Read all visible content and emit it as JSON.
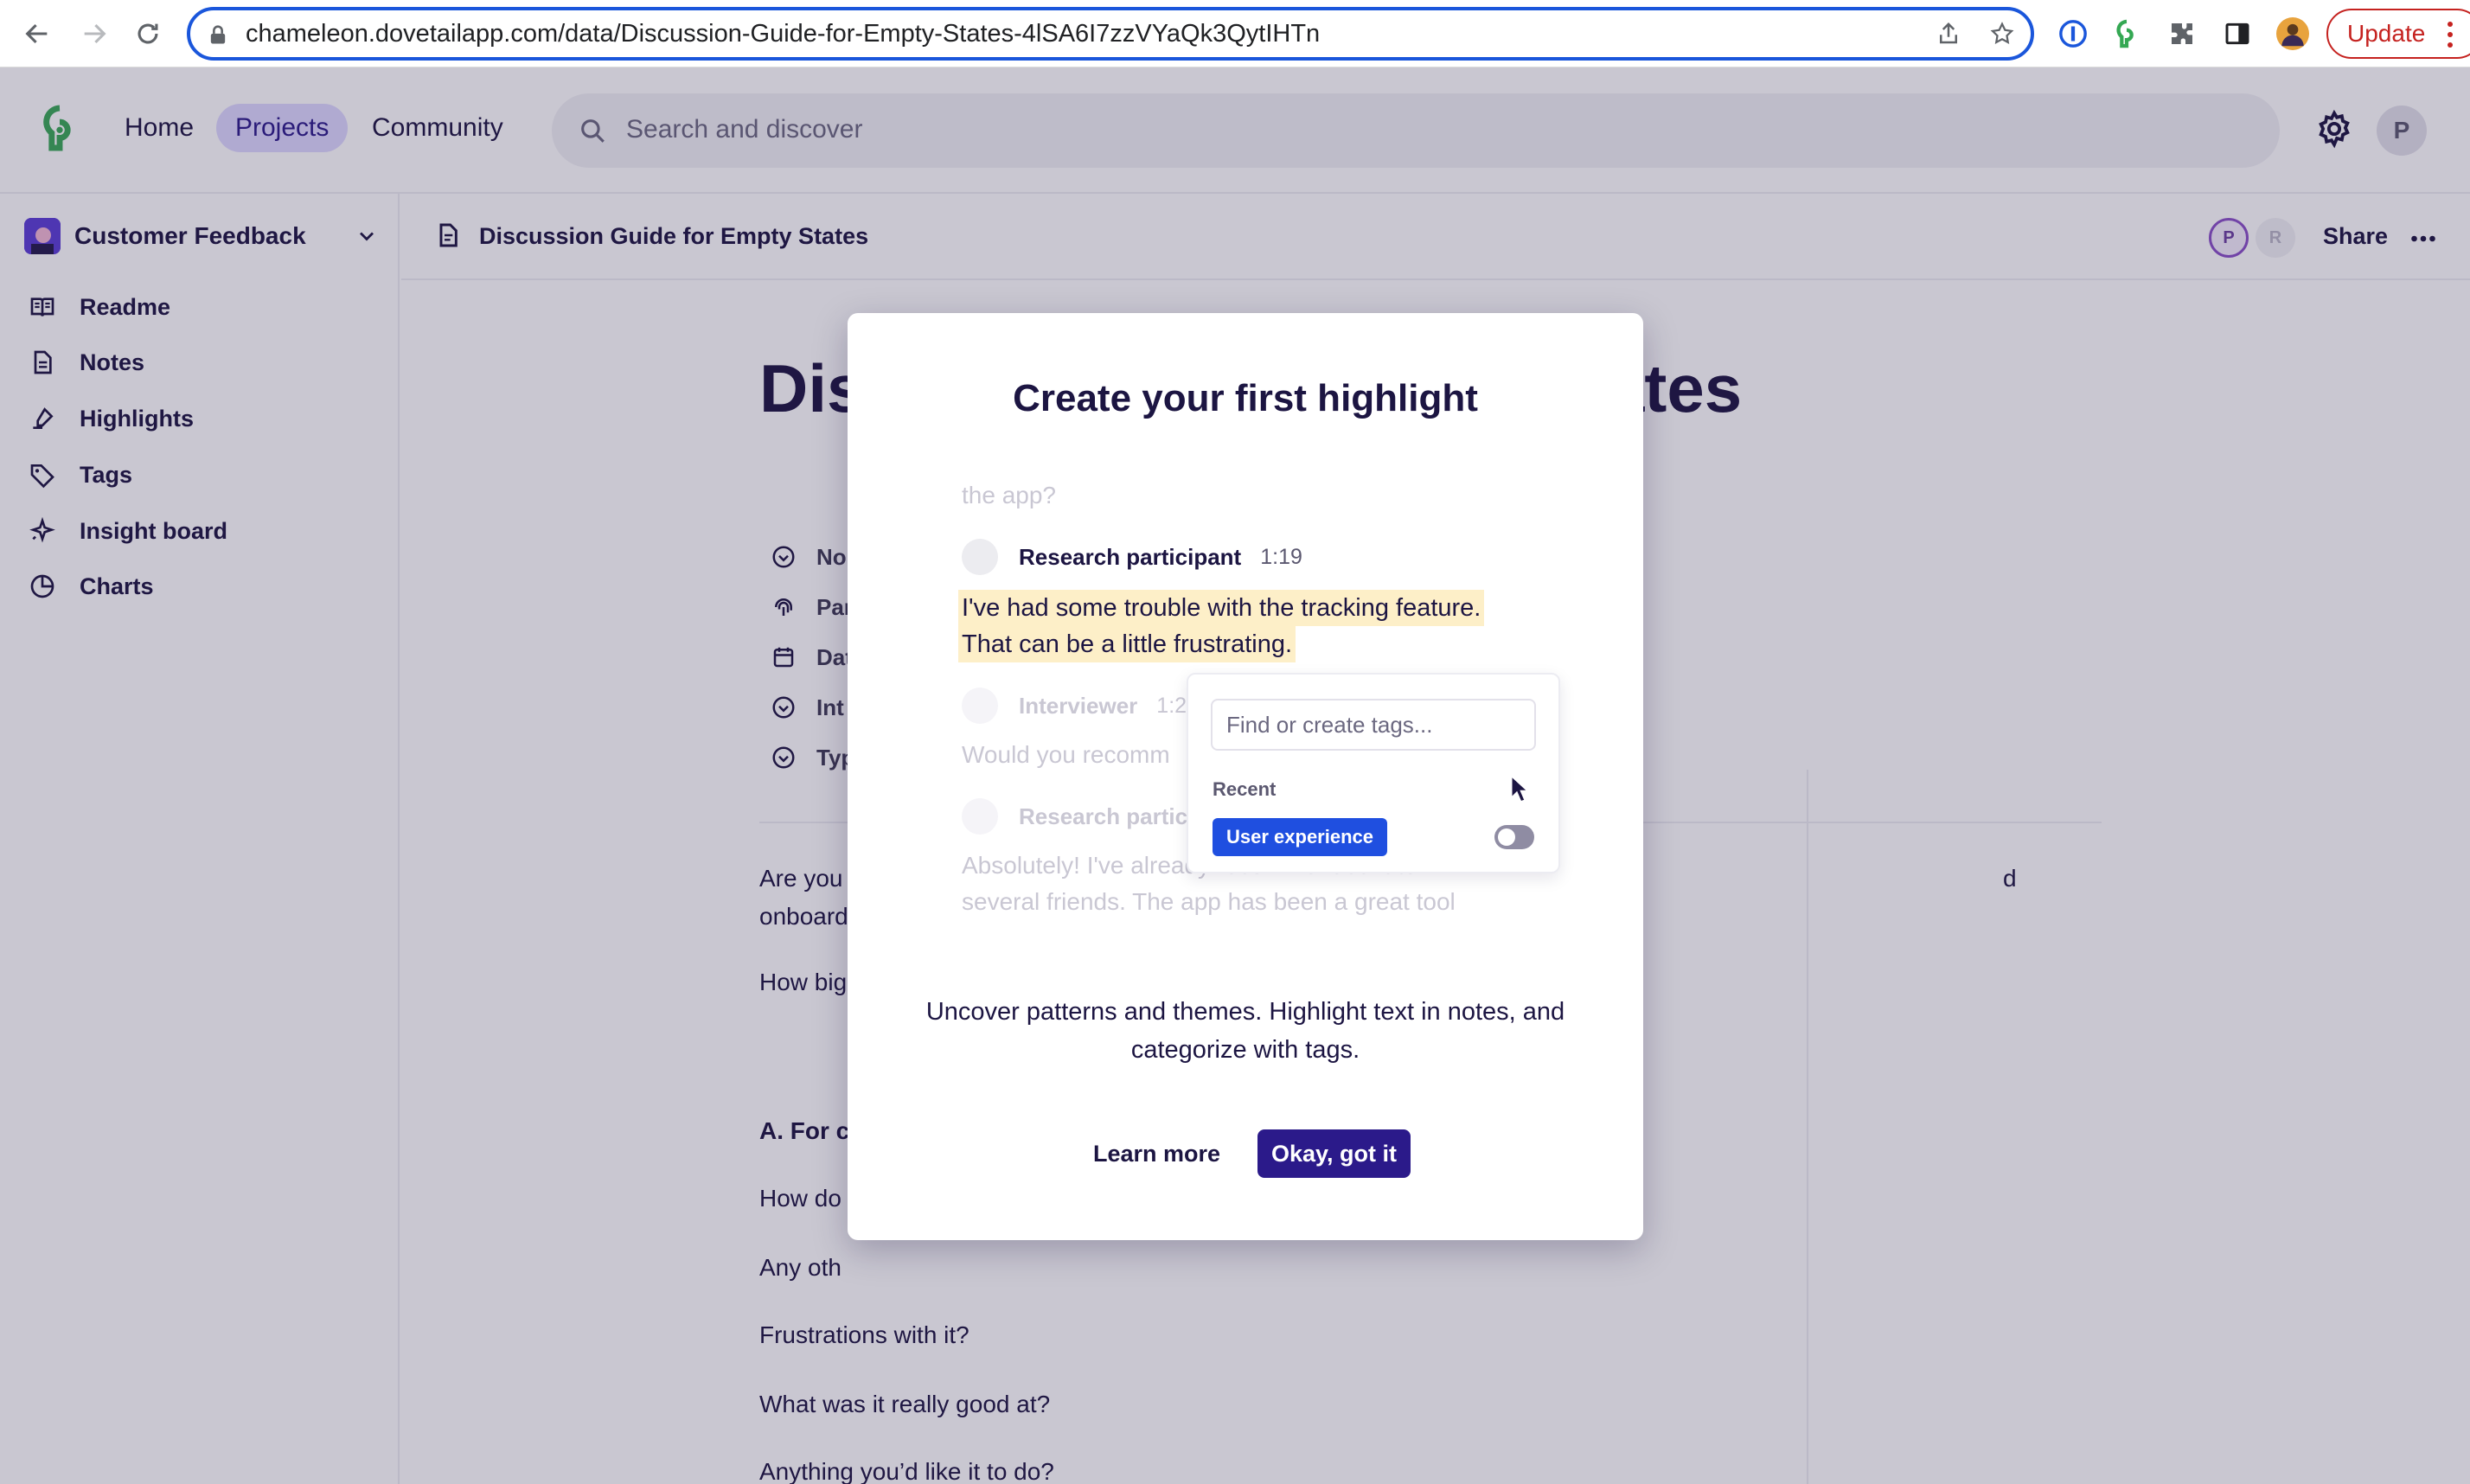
{
  "browser": {
    "url": "chameleon.dovetailapp.com/data/Discussion-Guide-for-Empty-States-4lSA6I7zzVYaQk3QytIHTn",
    "update_label": "Update"
  },
  "topnav": {
    "links": [
      "Home",
      "Projects",
      "Community"
    ],
    "active_link": "Projects",
    "search_placeholder": "Search and discover",
    "avatar_initial": "P"
  },
  "sidebar": {
    "workspace": "Customer Feedback",
    "items": [
      {
        "label": "Readme",
        "icon": "book-icon"
      },
      {
        "label": "Notes",
        "icon": "document-icon"
      },
      {
        "label": "Highlights",
        "icon": "highlighter-icon"
      },
      {
        "label": "Tags",
        "icon": "tag-icon"
      },
      {
        "label": "Insight board",
        "icon": "sparkle-icon"
      },
      {
        "label": "Charts",
        "icon": "pie-chart-icon"
      }
    ]
  },
  "docbar": {
    "title": "Discussion Guide for Empty States",
    "collaborators": [
      "P",
      "R"
    ],
    "share_label": "Share"
  },
  "document": {
    "title_head": "Dis",
    "title_tail": "ates",
    "properties": [
      "No",
      "Par",
      "Dat",
      "Int",
      "Typ"
    ],
    "paragraphs": [
      {
        "text": "Are you",
        "tail": "d"
      },
      {
        "text": "onboard"
      },
      {
        "text": "How big"
      },
      {
        "text": "A. For c"
      },
      {
        "text": "How do"
      },
      {
        "text": "Any oth"
      },
      {
        "text": "Frustrations with it?"
      },
      {
        "text": "What was it really good at?"
      },
      {
        "text": "Anything you’d like it to do?"
      }
    ]
  },
  "modal": {
    "title": "Create your first highlight",
    "demo": {
      "prev_line": "the app?",
      "speaker1": "Research participant",
      "time1": "1:19",
      "highlight_line1": "I've had some trouble with the tracking feature.",
      "highlight_line2": "That can be a little frustrating.",
      "speaker2": "Interviewer",
      "time2": "1:2",
      "line_q": "Would you recomm",
      "speaker3": "Research partic",
      "line_a1": "Absolutely! I've already recommended it to",
      "line_a2": "several friends. The app has been a great tool"
    },
    "tag_popover": {
      "placeholder": "Find or create tags...",
      "recent_label": "Recent",
      "tag": "User experience",
      "tag_color": "#1f4fe0"
    },
    "description": "Uncover patterns and themes. Highlight text in notes, and categorize with tags.",
    "learn_more": "Learn more",
    "ok_label": "Okay, got it"
  }
}
